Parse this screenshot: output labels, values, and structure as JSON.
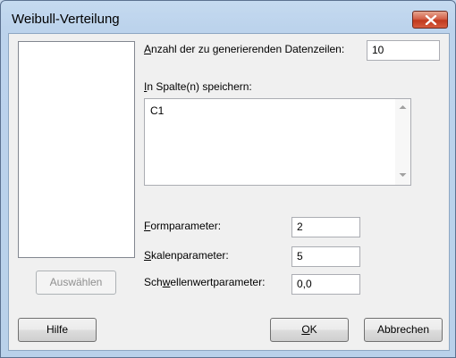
{
  "window": {
    "title": "Weibull-Verteilung"
  },
  "rows_label": {
    "mnemonic": "A",
    "rest": "nzahl der zu generierenden Datenzeilen:"
  },
  "rows_value": "10",
  "store_label": {
    "mnemonic": "I",
    "rest": "n Spalte(n) speichern:"
  },
  "store_value": "C1",
  "shape_label": {
    "mnemonic": "F",
    "rest": "ormparameter:"
  },
  "shape_value": "2",
  "scale_label": {
    "mnemonic": "S",
    "rest": "kalenparameter:"
  },
  "scale_value": "5",
  "threshold_label": {
    "pre": "Sch",
    "mnemonic": "w",
    "rest": "ellenwertparameter:"
  },
  "threshold_value": "0,0",
  "buttons": {
    "select": "Auswählen",
    "help": "Hilfe",
    "ok_mnemonic": "O",
    "ok_rest": "K",
    "cancel": "Abbrechen"
  },
  "icons": {
    "close": "close-icon",
    "scroll_up": "arrow-up-icon",
    "scroll_down": "arrow-down-icon"
  }
}
